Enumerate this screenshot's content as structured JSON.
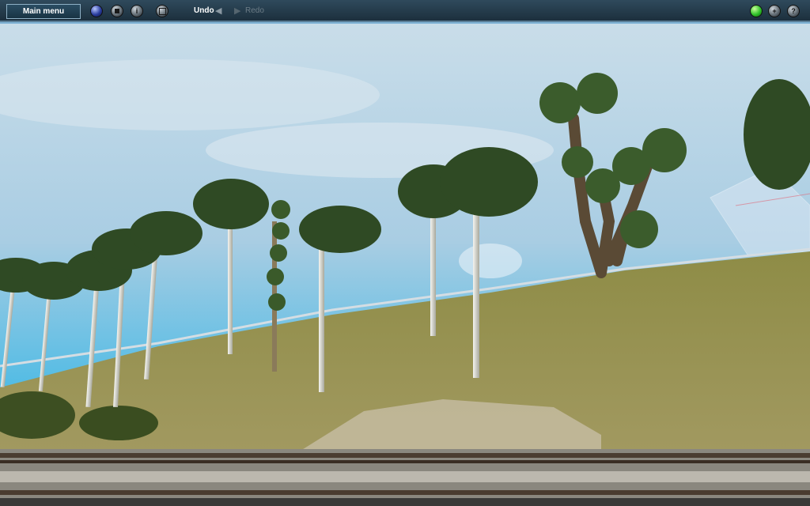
{
  "toolbar": {
    "main_menu_label": "Main menu",
    "undo_label": "Undo",
    "redo_label": "Redo",
    "icons": {
      "left": [
        "globe-icon",
        "stop-icon",
        "info-icon",
        "grid-icon"
      ],
      "right": [
        "status-light-icon",
        "add-icon",
        "help-icon"
      ]
    },
    "glyphs": {
      "info": "i",
      "add": "+",
      "help": "?",
      "undo_arrow": "◀",
      "redo_arrow": "▶"
    }
  },
  "scene": {
    "sky_colors": [
      "#cfe0ec",
      "#3fb8e6"
    ],
    "grass_color": "#8f8f4a",
    "track_color": "#5a4a3a"
  }
}
